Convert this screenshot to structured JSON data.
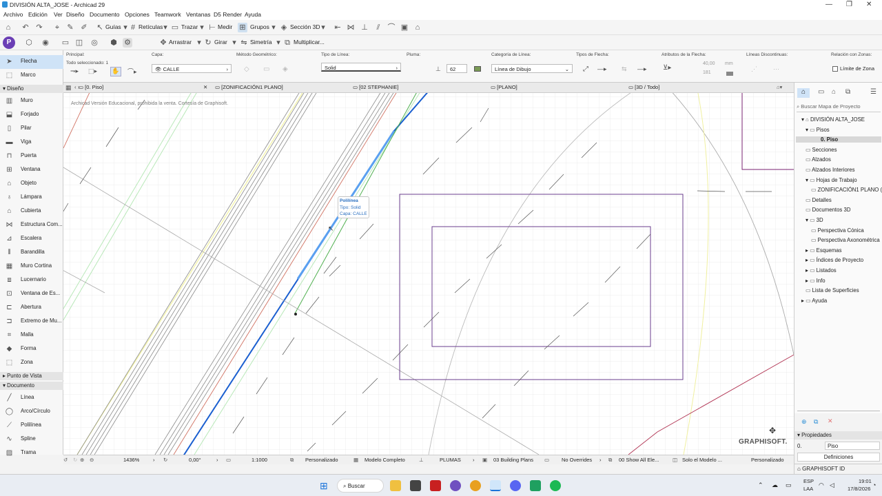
{
  "window": {
    "title": "DIVISIÓN ALTA_JOSE - Archicad 29",
    "controls": [
      "—",
      "❐",
      "✕"
    ]
  },
  "menu": [
    "Archivo",
    "Edición",
    "Ver",
    "Diseño",
    "Documento",
    "Opciones",
    "Teamwork",
    "Ventanas",
    "D5 Render",
    "Ayuda"
  ],
  "toolbar1": {
    "guias": "Guías",
    "reticulas": "Retículas",
    "trazar": "Trazar",
    "medir": "Medir",
    "grupos": "Grupos",
    "seccion3d": "Sección 3D"
  },
  "toolbar2": {
    "arrastrar": "Arrastrar",
    "girar": "Girar",
    "simetria": "Simetría",
    "multiplicar": "Multiplicar..."
  },
  "infobox": {
    "principal_label": "Principal:",
    "principal_value": "Todo seleccionado: 1",
    "capa_label": "Capa:",
    "capa_value": "CALLE",
    "metodo_label": "Método Geométrico:",
    "tipo_linea_label": "Tipo de Línea:",
    "tipo_linea_value": "Solid",
    "pluma_label": "Pluma:",
    "pluma_value": "62",
    "categoria_label": "Categoría de Línea:",
    "categoria_value": "Línea de Dibujo",
    "tipos_flecha_label": "Tipos de Flecha:",
    "atributos_label": "Atributos de la Flecha:",
    "atributos_value1": "40,00",
    "atributos_unit1": "mm",
    "atributos_value2": "181",
    "lineas_disc_label": "Líneas Discontinuas:",
    "relacion_label": "Relación con Zonas:",
    "limite_zona": "Límite de Zona"
  },
  "toolbox": {
    "flecha": "Flecha",
    "marco": "Marco",
    "diseno_section": "Diseño",
    "diseno_tools": [
      "Muro",
      "Forjado",
      "Pilar",
      "Viga",
      "Puerta",
      "Ventana",
      "Objeto",
      "Lámpara",
      "Cubierta",
      "Estructura Com...",
      "Escalera",
      "Barandilla",
      "Muro Cortina",
      "Lucernario",
      "Ventana de Es...",
      "Abertura",
      "Extremo de Mu...",
      "Malla",
      "Forma",
      "Zona"
    ],
    "punto_vista_section": "Punto de Vista",
    "documento_section": "Documento",
    "documento_tools": [
      "Línea",
      "Arco/Círculo",
      "Polilínea",
      "Spline",
      "Trama"
    ]
  },
  "tabs": [
    "[0. Piso]",
    "[ZONIFICACIÓN1 PLANO]",
    "[02 STEPHANIE]",
    "[PLANO]",
    "[3D / Todo]"
  ],
  "canvas": {
    "watermark": "Archicad Versión Educacional, prohibida la venta. Cortesía de Graphisoft.",
    "tooltip_title": "Polilínea",
    "tooltip_tipo": "Tipo: Solid",
    "tooltip_capa": "Capa: CALLE",
    "brand": "GRAPHISOFT."
  },
  "navigator": {
    "search_placeholder": "Buscar Mapa de Proyecto",
    "items": [
      "DIVISIÓN ALTA_JOSE",
      "Pisos",
      "0. Piso",
      "Secciones",
      "Alzados",
      "Alzados Interiores",
      "Hojas de Trabajo",
      "ZONIFICACIÓN1 PLANO (",
      "Detalles",
      "Documentos 3D",
      "3D",
      "Perspectiva Cónica",
      "Perspectiva Axonométrica",
      "Esquemas",
      "Índices de Proyecto",
      "Listados",
      "Info",
      "Lista de Superficies",
      "Ayuda"
    ]
  },
  "properties": {
    "header": "Propiedades",
    "id": "0.",
    "name": "Piso",
    "definiciones": "Definiciones",
    "graphisoft_id": "GRAPHISOFT ID"
  },
  "statusbar": {
    "zoom": "1436%",
    "angle": "0,00°",
    "scale": "1:1000",
    "personalizado1": "Personalizado",
    "modelo": "Modelo Completo",
    "plumas": "PLUMAS",
    "building": "03 Building Plans",
    "overrides": "No Overrides",
    "show": "00 Show All Ele...",
    "solo": "Solo el Modelo ...",
    "personalizado2": "Personalizado"
  },
  "taskbar": {
    "search": "Buscar",
    "lang1": "ESP",
    "lang2": "LAA",
    "time": "19:01",
    "date": "17/8/2026"
  }
}
